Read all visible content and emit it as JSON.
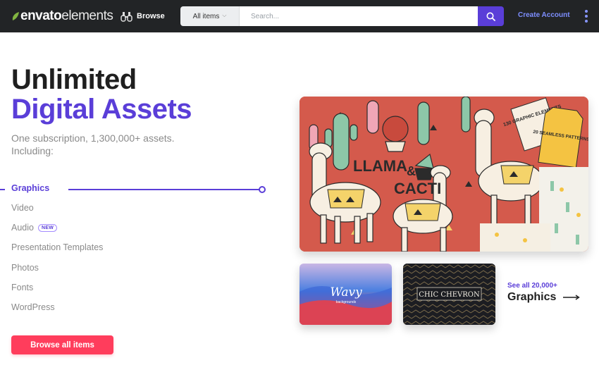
{
  "header": {
    "logo_bold": "envato",
    "logo_thin": "elements",
    "browse_label": "Browse",
    "search_scope": "All items",
    "search_placeholder": "Search...",
    "create_account": "Create Account"
  },
  "hero": {
    "headline_line1": "Unlimited",
    "headline_line2": "Digital Assets",
    "subtitle": "One subscription, 1,300,000+ assets. Including:"
  },
  "categories": [
    {
      "label": "Graphics",
      "active": true
    },
    {
      "label": "Video"
    },
    {
      "label": "Audio",
      "badge": "NEW"
    },
    {
      "label": "Presentation Templates"
    },
    {
      "label": "Photos"
    },
    {
      "label": "Fonts"
    },
    {
      "label": "WordPress"
    }
  ],
  "cta": {
    "browse_all": "Browse all items"
  },
  "featured": {
    "main_title_1": "LLAMA",
    "main_title_amp": "&",
    "main_title_2": "CACTI",
    "tag_elements": "130 GRAPHIC ELEMENTS",
    "tag_patterns": "20 SEAMLESS PATTERNS",
    "thumb1_title": "Wavy",
    "thumb1_sub": "backgrounds",
    "thumb2_title": "CHIC CHEVRON",
    "see_all_small": "See all 20,000+",
    "see_all_big": "Graphics"
  },
  "colors": {
    "accent": "#5a3ed8",
    "cta": "#ff3d5c",
    "topbar": "#222426",
    "logo_green": "#82b541"
  }
}
